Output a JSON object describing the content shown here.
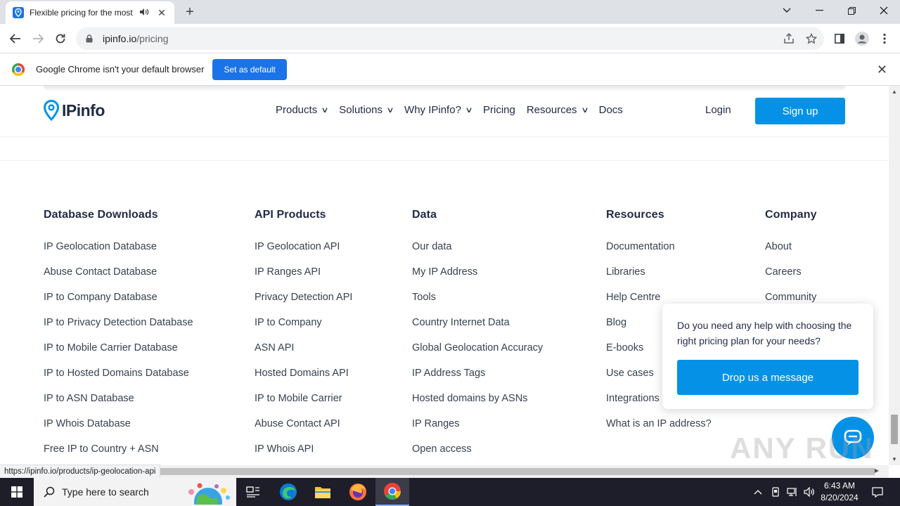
{
  "browser": {
    "tab_title": "Flexible pricing for the most",
    "url_host": "ipinfo.io",
    "url_path": "/pricing",
    "infobar_message": "Google Chrome isn't your default browser",
    "infobar_button": "Set as default",
    "status_url": "https://ipinfo.io/products/ip-geolocation-api"
  },
  "site": {
    "logo_text": "IPinfo",
    "nav": [
      {
        "label": "Products",
        "dropdown": true
      },
      {
        "label": "Solutions",
        "dropdown": true
      },
      {
        "label": "Why IPinfo?",
        "dropdown": true
      },
      {
        "label": "Pricing",
        "dropdown": false
      },
      {
        "label": "Resources",
        "dropdown": true
      },
      {
        "label": "Docs",
        "dropdown": false
      }
    ],
    "login": "Login",
    "signup": "Sign up"
  },
  "footer": {
    "columns": [
      {
        "heading": "Database Downloads",
        "links": [
          "IP Geolocation Database",
          "Abuse Contact Database",
          "IP to Company Database",
          "IP to Privacy Detection Database",
          "IP to Mobile Carrier Database",
          "IP to Hosted Domains Database",
          "IP to ASN Database",
          "IP Whois Database",
          "Free IP to Country + ASN"
        ]
      },
      {
        "heading": "API Products",
        "links": [
          "IP Geolocation API",
          "IP Ranges API",
          "Privacy Detection API",
          "IP to Company",
          "ASN API",
          "Hosted Domains API",
          "IP to Mobile Carrier",
          "Abuse Contact API",
          "IP Whois API"
        ]
      },
      {
        "heading": "Data",
        "links": [
          "Our data",
          "My IP Address",
          "Tools",
          "Country Internet Data",
          "Global Geolocation Accuracy",
          "IP Address Tags",
          "Hosted domains by ASNs",
          "IP Ranges",
          "Open access"
        ]
      },
      {
        "heading": "Resources",
        "links": [
          "Documentation",
          "Libraries",
          "Help Centre",
          "Blog",
          "E-books",
          "Use cases",
          "Integrations",
          "What is an IP address?"
        ]
      },
      {
        "heading": "Company",
        "links": [
          "About",
          "Careers",
          "Community"
        ]
      }
    ]
  },
  "help_popup": {
    "text": "Do you need any help with choosing the right pricing plan for your needs?",
    "button": "Drop us a message"
  },
  "watermark": "ANY RUN",
  "taskbar": {
    "search_placeholder": "Type here to search",
    "time": "6:43 AM",
    "date": "8/20/2024"
  },
  "colors": {
    "brand_blue": "#0592e6",
    "chrome_blue": "#1a73e8",
    "taskbar": "#1e1e2a"
  }
}
